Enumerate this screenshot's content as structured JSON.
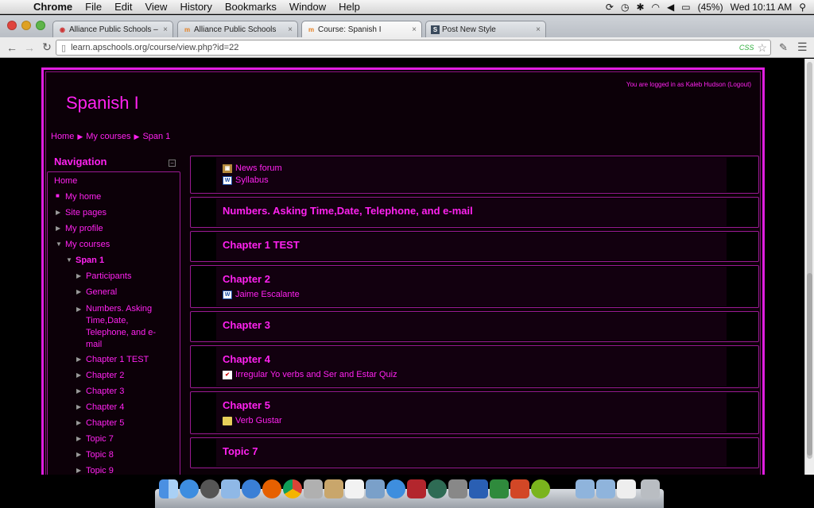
{
  "menubar": {
    "app": "Chrome",
    "items": [
      "File",
      "Edit",
      "View",
      "History",
      "Bookmarks",
      "Window",
      "Help"
    ],
    "battery": "(45%)",
    "clock": "Wed 10:11 AM"
  },
  "browser": {
    "tabs": [
      {
        "title": "Alliance Public Schools – D",
        "icon": "globe-icon"
      },
      {
        "title": "Alliance Public Schools",
        "icon": "moodle-icon"
      },
      {
        "title": "Course: Spanish I",
        "icon": "moodle-icon"
      },
      {
        "title": "Post New Style",
        "icon": "s-icon"
      }
    ],
    "active_tab": 2,
    "url": "learn.apschools.org/course/view.php?id=22",
    "css_badge": "CSS"
  },
  "page": {
    "login_text": "You are logged in as Kaleb Hudson (Logout)",
    "course_title": "Spanish I",
    "breadcrumb": [
      "Home",
      "My courses",
      "Span 1"
    ],
    "navigation": {
      "header": "Navigation",
      "items": [
        {
          "label": "Home"
        },
        {
          "label": "My home"
        },
        {
          "label": "Site pages"
        },
        {
          "label": "My profile"
        },
        {
          "label": "My courses"
        },
        {
          "label": "Span 1"
        },
        {
          "label": "Participants"
        },
        {
          "label": "General"
        },
        {
          "label": "Numbers. Asking Time,Date, Telephone, and e-mail"
        },
        {
          "label": "Chapter 1 TEST"
        },
        {
          "label": "Chapter 2"
        },
        {
          "label": "Chapter 3"
        },
        {
          "label": "Chapter 4"
        },
        {
          "label": "Chapter 5"
        },
        {
          "label": "Topic 7"
        },
        {
          "label": "Topic 8"
        },
        {
          "label": "Topic 9"
        }
      ]
    },
    "sections": [
      {
        "title": "",
        "activities": [
          {
            "icon": "forum-icon",
            "label": "News forum"
          },
          {
            "icon": "word-icon",
            "label": "Syllabus"
          }
        ]
      },
      {
        "title": "Numbers. Asking Time,Date, Telephone, and e-mail",
        "activities": []
      },
      {
        "title": "Chapter 1 TEST",
        "activities": []
      },
      {
        "title": "Chapter 2",
        "activities": [
          {
            "icon": "word-icon",
            "label": "Jaime Escalante"
          }
        ]
      },
      {
        "title": "Chapter 3",
        "activities": []
      },
      {
        "title": "Chapter 4",
        "activities": [
          {
            "icon": "quiz-icon",
            "label": "Irregular Yo verbs and Ser and Estar Quiz"
          }
        ]
      },
      {
        "title": "Chapter 5",
        "activities": [
          {
            "icon": "folder-icon",
            "label": "Verb Gustar"
          }
        ]
      },
      {
        "title": "Topic 7",
        "activities": []
      }
    ]
  },
  "colors": {
    "accent": "#ff22f0",
    "border": "#9a1a93",
    "background": "#0c0008"
  }
}
